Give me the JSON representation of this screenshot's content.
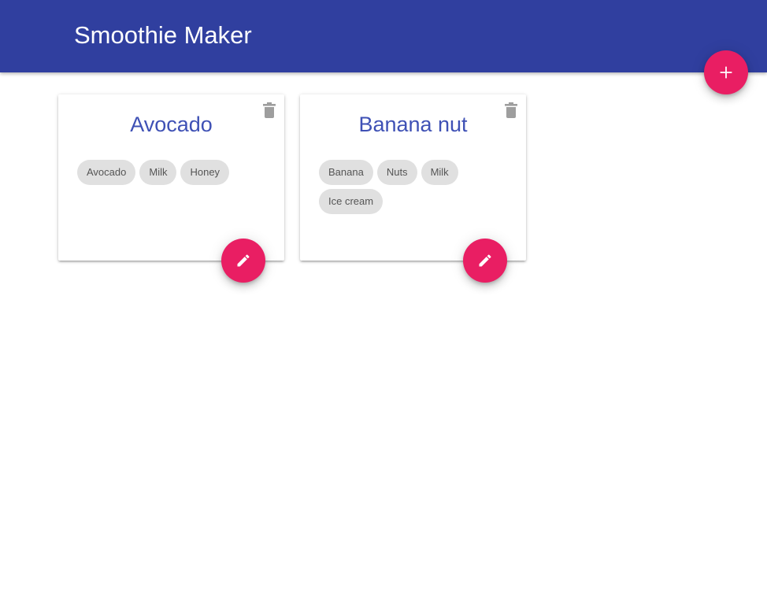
{
  "app": {
    "title": "Smoothie Maker"
  },
  "icons": {
    "add": "plus-icon",
    "delete": "trash-icon",
    "edit": "pencil-icon"
  },
  "colors": {
    "app_bar": "#303f9f",
    "accent": "#e91e63",
    "card_title": "#3f51b5",
    "chip_background": "#e0e0e0",
    "delete_icon": "#9e9e9e"
  },
  "recipes": [
    {
      "name": "Avocado",
      "ingredients": [
        "Avocado",
        "Milk",
        "Honey"
      ]
    },
    {
      "name": "Banana nut",
      "ingredients": [
        "Banana",
        "Nuts",
        "Milk",
        "Ice cream"
      ]
    }
  ]
}
